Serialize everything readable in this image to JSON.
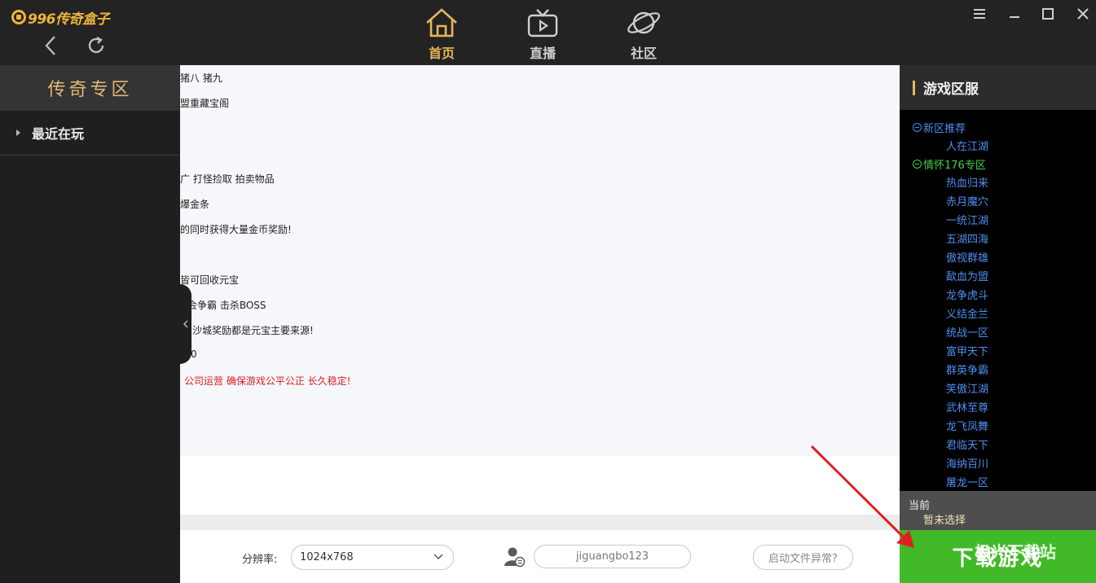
{
  "app": {
    "logo_text": "996传奇盒子"
  },
  "tabs": [
    {
      "label": "首页"
    },
    {
      "label": "直播"
    },
    {
      "label": "社区"
    }
  ],
  "sidebar": {
    "title": "传奇专区",
    "recent_label": "最近在玩"
  },
  "content": {
    "lines": [
      {
        "text": "猪八 猪九",
        "red": false
      },
      {
        "text": "盟重藏宝阁",
        "red": false
      },
      {
        "text": "广 打怪捡取 拍卖物品",
        "red": false
      },
      {
        "text": "爆金条",
        "red": false
      },
      {
        "text": "的同时获得大量金币奖励!",
        "red": false
      },
      {
        "text": "皆可回收元宝",
        "red": false
      },
      {
        "text": "会争霸 击杀BOSS",
        "red": false
      },
      {
        "text": "沙城奖励都是元宝主要来源!",
        "red": false
      },
      {
        "text": "0",
        "red": false
      },
      {
        "text": "公司运营 确保游戏公平公正 长久稳定!",
        "red": true
      }
    ]
  },
  "footer": {
    "resolution_label": "分辨率:",
    "resolution_value": "1024x768",
    "username": "jiguangbo123",
    "launch_error_label": "启动文件异常?"
  },
  "servers": {
    "title": "游戏区服",
    "groups": [
      {
        "name": "新区推荐",
        "color": "#4d8ff0",
        "items": [
          "人在江湖"
        ]
      },
      {
        "name": "情怀176专区",
        "color": "#3ed24a",
        "items": [
          "热血归来",
          "赤月魔穴",
          "一统江湖",
          "五湖四海",
          "傲视群雄",
          "歃血为盟",
          "龙争虎斗",
          "义结金兰",
          "统战一区",
          "富甲天下",
          "群英争霸",
          "笑傲江湖",
          "武林至尊",
          "龙飞凤舞",
          "君临天下",
          "海纳百川",
          "屠龙一区"
        ]
      }
    ],
    "current_label": "当前",
    "current_value": "暂未选择",
    "download_label": "下载游戏"
  },
  "watermark": "极光下载站",
  "colors": {
    "accent": "#e9b45a",
    "download_green": "#42b928",
    "server_blue": "#4d8ff0",
    "group_green": "#3ed24a",
    "annotation_arrow": "#e02020"
  }
}
